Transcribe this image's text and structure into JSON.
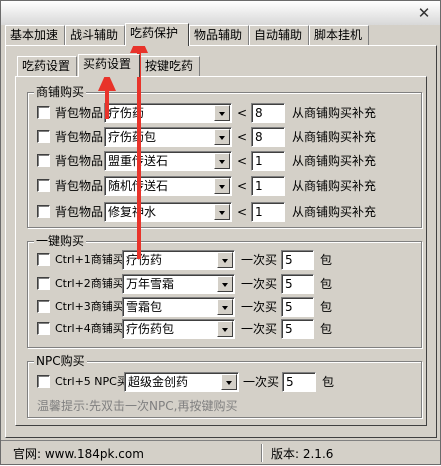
{
  "window": {
    "close_glyph": "✕"
  },
  "tabs": [
    "基本加速",
    "战斗辅助",
    "吃药保护",
    "物品辅助",
    "自动辅助",
    "脚本挂机"
  ],
  "subtabs": [
    "吃药设置",
    "买药设置",
    "按键吃药"
  ],
  "shop_group": {
    "title": "商铺购买",
    "rows": [
      {
        "label": "背包物品",
        "item": "疗伤药",
        "op": "<",
        "qty": "8",
        "suffix": "从商铺购买补充"
      },
      {
        "label": "背包物品",
        "item": "疗伤药包",
        "op": "<",
        "qty": "8",
        "suffix": "从商铺购买补充"
      },
      {
        "label": "背包物品",
        "item": "盟重传送石",
        "op": "<",
        "qty": "1",
        "suffix": "从商铺购买补充"
      },
      {
        "label": "背包物品",
        "item": "随机传送石",
        "op": "<",
        "qty": "1",
        "suffix": "从商铺购买补充"
      },
      {
        "label": "背包物品",
        "item": "修复神水",
        "op": "<",
        "qty": "1",
        "suffix": "从商铺购买补充"
      }
    ]
  },
  "quick_group": {
    "title": "一键购买",
    "rows": [
      {
        "label": "Ctrl+1商铺买",
        "item": "疗伤药",
        "text": "一次买",
        "qty": "5",
        "unit": "包"
      },
      {
        "label": "Ctrl+2商铺买",
        "item": "万年雪霜",
        "text": "一次买",
        "qty": "5",
        "unit": "包"
      },
      {
        "label": "Ctrl+3商铺买",
        "item": "雪霜包",
        "text": "一次买",
        "qty": "5",
        "unit": "包"
      },
      {
        "label": "Ctrl+4商铺买",
        "item": "疗伤药包",
        "text": "一次买",
        "qty": "5",
        "unit": "包"
      }
    ]
  },
  "npc_group": {
    "title": "NPC购买",
    "row": {
      "label": "Ctrl+5 NPC买",
      "item": "超级金创药",
      "text": "一次买",
      "qty": "5",
      "unit": "包"
    },
    "hint": "温馨提示:先双击一次NPC,再按键购买"
  },
  "status": {
    "website": "官网: www.184pk.com",
    "version": "版本: 2.1.6"
  },
  "colors": {
    "arrow": "#e8332a",
    "face": "#d4d0c8"
  }
}
